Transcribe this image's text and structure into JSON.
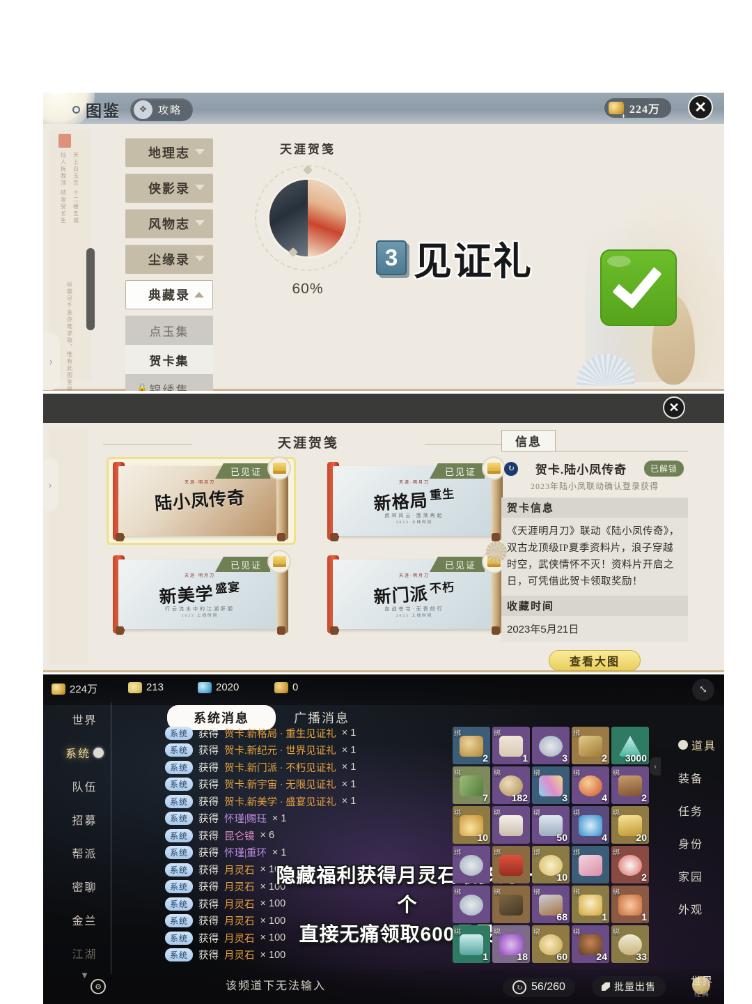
{
  "panel1": {
    "tab_main": "图鉴",
    "tab_guide": "攻略",
    "guide_icon": "scroll-icon",
    "currency": "224万",
    "close_icon": "✕",
    "sidebar": [
      {
        "label": "地理志",
        "state": "collapsed"
      },
      {
        "label": "侠影录",
        "state": "collapsed"
      },
      {
        "label": "风物志",
        "state": "collapsed"
      },
      {
        "label": "尘缘录",
        "state": "collapsed"
      },
      {
        "label": "典藏录",
        "state": "expanded"
      }
    ],
    "sub_items": [
      {
        "label": "点玉集",
        "locked": false,
        "active": false
      },
      {
        "label": "贺卡集",
        "locked": false,
        "active": true
      },
      {
        "label": "锦绣集",
        "locked": true,
        "active": false
      }
    ],
    "wheel_title": "天涯贺笺",
    "wheel_percent": "60%",
    "claim_number": "3",
    "claim_label": "见证礼",
    "vertical_text_1": "仙人抚我顶  结发受长生",
    "vertical_text_2": "天上白玉京  十二楼五城",
    "vertical_text_3": "纵散尽千金亦难求取，惟有此图鉴最是珍奇"
  },
  "panel2": {
    "close_icon": "✕",
    "section_title": "天涯贺笺",
    "cards": [
      {
        "title": "陆小凤传奇",
        "sub": "",
        "mini": "天涯·明月刀",
        "foot": "",
        "ribbon": "已见证",
        "selected": true,
        "style": "c1"
      },
      {
        "title": "新格局",
        "suffix": "重生",
        "sub": "武林风云·激荡再起",
        "mini": "天涯·明月刀",
        "foot": "2023  上线时间",
        "ribbon": "已见证",
        "selected": false,
        "style": "c2"
      },
      {
        "title": "新美学",
        "suffix": "盛宴",
        "sub": "行云流水中的江湖肝胆",
        "mini": "天涯·明月刀",
        "foot": "2023  上线时间",
        "ribbon": "已见证",
        "selected": false,
        "style": "c2"
      },
      {
        "title": "新门派",
        "suffix": "不朽",
        "sub": "血战苍穹·无畏前行",
        "mini": "天涯·明月刀",
        "foot": "2023  上线时间",
        "ribbon": "已见证",
        "selected": false,
        "style": "c2"
      }
    ],
    "info": {
      "tab": "信息",
      "refresh_icon": "↻",
      "name": "贺卡.陆小凤传奇",
      "badge": "已解锁",
      "subtitle": "2023年陆小凤联动确认登录获得",
      "section1_header": "贺卡信息",
      "section1_body": "《天涯明月刀》联动《陆小凤传奇》，双古龙顶级IP夏季资料片，浪子穿越时空，武侠情怀不灭！资料片开启之日，可凭借此贺卡领取奖励！",
      "section2_header": "收藏时间",
      "section2_body": "2023年5月21日",
      "button": "查看大图"
    }
  },
  "panel3": {
    "currencies": [
      {
        "icon": "gold-icon",
        "value": "224万"
      },
      {
        "icon": "leaf-icon",
        "value": "213"
      },
      {
        "icon": "orb-icon",
        "value": "2020"
      },
      {
        "icon": "pouch-icon",
        "value": "0"
      }
    ],
    "expand_icon": "⤡",
    "channels": [
      {
        "label": "世界",
        "active": false,
        "dim": false
      },
      {
        "label": "系统",
        "active": true,
        "dim": false
      },
      {
        "label": "队伍",
        "active": false,
        "dim": false
      },
      {
        "label": "招募",
        "active": false,
        "dim": false
      },
      {
        "label": "帮派",
        "active": false,
        "dim": false
      },
      {
        "label": "密聊",
        "active": false,
        "dim": false
      },
      {
        "label": "金兰",
        "active": false,
        "dim": false
      },
      {
        "label": "江湖",
        "active": false,
        "dim": true
      }
    ],
    "channel_arrow": "▼",
    "tabs": [
      {
        "label": "系统消息",
        "selected": true
      },
      {
        "label": "广播消息",
        "selected": false
      }
    ],
    "chat_lines": [
      {
        "tag": "系统",
        "verb": "获得",
        "item": "贺卡.新格局 · 重生见证礼",
        "color": "orange",
        "count": "× 1"
      },
      {
        "tag": "系统",
        "verb": "获得",
        "item": "贺卡.新纪元 · 世界见证礼",
        "color": "orange",
        "count": "× 1"
      },
      {
        "tag": "系统",
        "verb": "获得",
        "item": "贺卡.新门派 · 不朽见证礼",
        "color": "orange",
        "count": "× 1"
      },
      {
        "tag": "系统",
        "verb": "获得",
        "item": "贺卡.新宇宙 · 无限见证礼",
        "color": "orange",
        "count": "× 1"
      },
      {
        "tag": "系统",
        "verb": "获得",
        "item": "贺卡.新美学 · 盛宴见证礼",
        "color": "orange",
        "count": "× 1"
      },
      {
        "tag": "系统",
        "verb": "获得",
        "item": "怀瑾|赐珏",
        "color": "purple",
        "count": "× 1"
      },
      {
        "tag": "系统",
        "verb": "获得",
        "item": "昆仑镜",
        "color": "pink",
        "count": "× 6"
      },
      {
        "tag": "系统",
        "verb": "获得",
        "item": "怀瑾|重环",
        "color": "purple",
        "count": "× 1"
      },
      {
        "tag": "系统",
        "verb": "获得",
        "item": "月灵石",
        "color": "orange",
        "count": "× 100"
      },
      {
        "tag": "系统",
        "verb": "获得",
        "item": "月灵石",
        "color": "orange",
        "count": "× 100"
      },
      {
        "tag": "系统",
        "verb": "获得",
        "item": "月灵石",
        "color": "orange",
        "count": "× 100"
      },
      {
        "tag": "系统",
        "verb": "获得",
        "item": "月灵石",
        "color": "orange",
        "count": "× 100"
      },
      {
        "tag": "系统",
        "verb": "获得",
        "item": "月灵石",
        "color": "orange",
        "count": "× 100"
      },
      {
        "tag": "系统",
        "verb": "获得",
        "item": "月灵石",
        "color": "orange",
        "count": "× 100"
      }
    ],
    "subtitle_line1": "隐藏福利获得月灵石最多的一个",
    "subtitle_line2": "直接无痛领取600月灵石",
    "bag": [
      [
        {
          "bind": "绑",
          "qty": "2",
          "bg": "#3c5d77",
          "art": "#c9a24e"
        },
        {
          "bind": "绑",
          "qty": "1",
          "bg": "#6a4c86",
          "art": "#e6dcc6"
        },
        {
          "bind": "",
          "qty": "3",
          "bg": "#6a4c86",
          "art": "#dfe4e7"
        },
        {
          "bind": "绑",
          "qty": "2",
          "bg": "#9a7a46",
          "art": "#d9b468"
        },
        {
          "bind": "",
          "qty": "3000",
          "bg": "#2f7a63",
          "art": "#8fe2d8"
        }
      ],
      [
        {
          "bind": "绑",
          "qty": "7",
          "bg": "#7e8a5c",
          "art": "#7fa05a"
        },
        {
          "bind": "绑",
          "qty": "182",
          "bg": "#6a4c86",
          "art": "#d8c08a"
        },
        {
          "bind": "绑",
          "qty": "3",
          "bg": "#3c5d77",
          "art": "#e08ccd"
        },
        {
          "bind": "绑",
          "qty": "4",
          "bg": "#6a4c86",
          "art": "#e8903a"
        },
        {
          "bind": "绑",
          "qty": "2",
          "bg": "#6a4c86",
          "art": "#b07a48"
        }
      ],
      [
        {
          "bind": "绑",
          "qty": "10",
          "bg": "#8f7a44",
          "art": "#e9c86a"
        },
        {
          "bind": "绑",
          "qty": "",
          "bg": "#6a4c86",
          "art": "#efe7d4"
        },
        {
          "bind": "绑",
          "qty": "50",
          "bg": "#6a4c86",
          "art": "#cfd9e4"
        },
        {
          "bind": "绑",
          "qty": "4",
          "bg": "#5a4b7e",
          "art": "#6fc6f0"
        },
        {
          "bind": "绑",
          "qty": "20",
          "bg": "#8f7a44",
          "art": "#f0d479"
        }
      ],
      [
        {
          "bind": "绑",
          "qty": "",
          "bg": "#6a4c86",
          "art": "#dfe4e7"
        },
        {
          "bind": "绑",
          "qty": "",
          "bg": "#8a6a42",
          "art": "#d8604a"
        },
        {
          "bind": "绑",
          "qty": "10",
          "bg": "#8a7a46",
          "art": "#f1e3a8"
        },
        {
          "bind": "绑",
          "qty": "",
          "bg": "#3c5d77",
          "art": "#f0b9c9"
        },
        {
          "bind": "绑",
          "qty": "2",
          "bg": "#8a4a44",
          "art": "#f2dede"
        }
      ],
      [
        {
          "bind": "绑",
          "qty": "",
          "bg": "#6a4c86",
          "art": "#dfe4e7"
        },
        {
          "bind": "绑",
          "qty": "",
          "bg": "#8a6a42",
          "art": "#6b5a3a"
        },
        {
          "bind": "绑",
          "qty": "68",
          "bg": "#6a4c86",
          "art": "#b0783f"
        },
        {
          "bind": "绑",
          "qty": "1",
          "bg": "#8a7a46",
          "art": "#f6e09a"
        },
        {
          "bind": "绑",
          "qty": "1",
          "bg": "#8a5a44",
          "art": "#e08a5a"
        }
      ],
      [
        {
          "bind": "绑",
          "qty": "1",
          "bg": "#2f7a63",
          "art": "#8fd8e2"
        },
        {
          "bind": "绑",
          "qty": "18",
          "bg": "#7e6a8a",
          "art": "#b06ad0"
        },
        {
          "bind": "绑",
          "qty": "60",
          "bg": "#8f7a44",
          "art": "#e6cf86"
        },
        {
          "bind": "绑",
          "qty": "24",
          "bg": "#6a4c86",
          "art": "#8a5a32"
        },
        {
          "bind": "绑",
          "qty": "33",
          "bg": "#8a7a46",
          "art": "#efe2bb"
        }
      ]
    ],
    "right_menu": [
      {
        "label": "道具",
        "active": true
      },
      {
        "label": "装备",
        "active": false
      },
      {
        "label": "任务",
        "active": false
      },
      {
        "label": "身份",
        "active": false
      },
      {
        "label": "家园",
        "active": false
      },
      {
        "label": "外观",
        "active": false
      }
    ],
    "gear_icon": "⚙",
    "input_hint": "该频道下无法输入",
    "capacity": "56/260",
    "capacity_icon": "↻",
    "sell_button": "批量出售",
    "world_label": "世界",
    "world_sub": "经典"
  }
}
